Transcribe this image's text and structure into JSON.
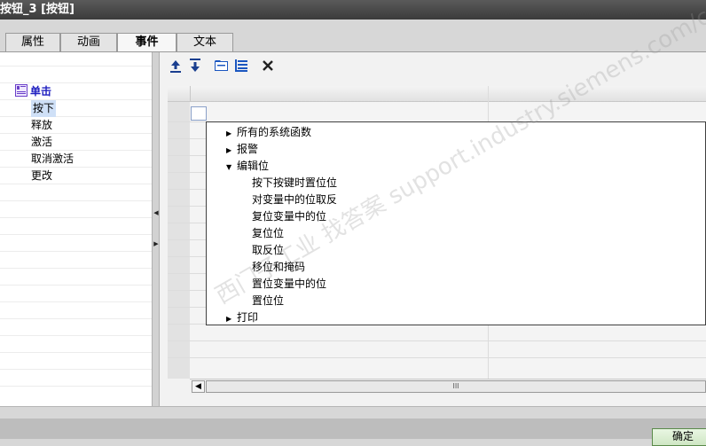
{
  "window": {
    "title": "按钮_3 [按钮]"
  },
  "tabs": [
    {
      "label": "属性"
    },
    {
      "label": "动画"
    },
    {
      "label": "事件"
    },
    {
      "label": "文本"
    }
  ],
  "tree": {
    "root": "单击",
    "items": [
      "按下",
      "释放",
      "激活",
      "取消激活",
      "更改"
    ]
  },
  "toolbar": {
    "icons": [
      "move-up-icon",
      "move-down-icon",
      "folder-icon",
      "list-icon",
      "delete-icon"
    ]
  },
  "dropdown": {
    "items": [
      {
        "label": "所有的系统函数",
        "expanded": false
      },
      {
        "label": "报警",
        "expanded": false
      },
      {
        "label": "编辑位",
        "expanded": true,
        "children": [
          "按下按键时置位位",
          "对变量中的位取反",
          "复位变量中的位",
          "复位位",
          "取反位",
          "移位和掩码",
          "置位变量中的位",
          "置位位"
        ]
      },
      {
        "label": "打印",
        "expanded": false
      }
    ]
  },
  "watermark": {
    "text": "西门子工业  找答案  support.industry.siemens.com/cs"
  },
  "scrollbar": {
    "thumb_glyph": "III"
  },
  "footer": {
    "ok_label": "确定"
  },
  "colors": {
    "tree_root": "#1d1dbf",
    "title_bg": "#3b3b3b",
    "ok_border": "#5a8a4a"
  }
}
